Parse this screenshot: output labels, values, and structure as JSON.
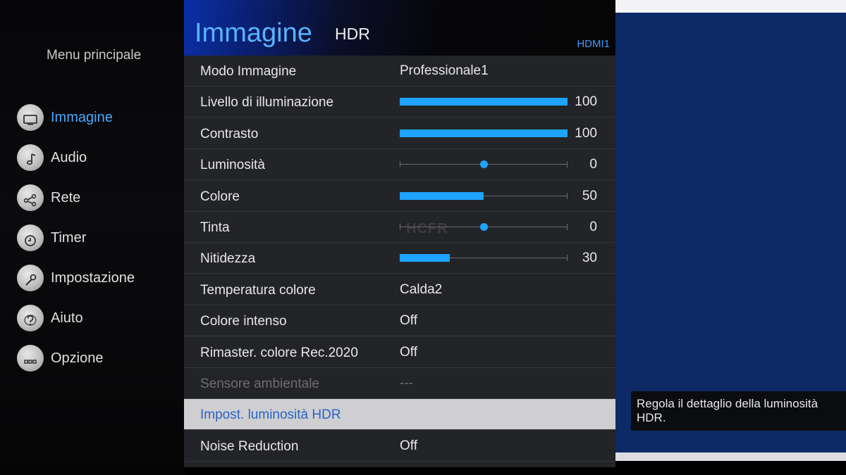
{
  "main_menu": {
    "title": "Menu principale",
    "items": [
      {
        "label": "Immagine",
        "icon": "tv-icon",
        "active": true
      },
      {
        "label": "Audio",
        "icon": "music-note-icon",
        "active": false
      },
      {
        "label": "Rete",
        "icon": "share-network-icon",
        "active": false
      },
      {
        "label": "Timer",
        "icon": "clock-icon",
        "active": false
      },
      {
        "label": "Impostazione",
        "icon": "wrench-icon",
        "active": false
      },
      {
        "label": "Aiuto",
        "icon": "help-icon",
        "active": false
      },
      {
        "label": "Opzione",
        "icon": "options-dots-icon",
        "active": false
      }
    ]
  },
  "panel": {
    "title": "Immagine",
    "subtitle": "HDR",
    "source": "HDMI1",
    "rows": [
      {
        "label": "Modo Immagine",
        "type": "value",
        "value": "Professionale1"
      },
      {
        "label": "Livello di illuminazione",
        "type": "slider",
        "value": "100",
        "level": 1.0,
        "style": "fill"
      },
      {
        "label": "Contrasto",
        "type": "slider",
        "value": "100",
        "level": 1.0,
        "style": "fill"
      },
      {
        "label": "Luminosità",
        "type": "slider",
        "value": "0",
        "level": 0.5,
        "style": "knob"
      },
      {
        "label": "Colore",
        "type": "slider",
        "value": "50",
        "level": 0.5,
        "style": "fill"
      },
      {
        "label": "Tinta",
        "type": "slider",
        "value": "0",
        "level": 0.5,
        "style": "knob"
      },
      {
        "label": "Nitidezza",
        "type": "slider",
        "value": "30",
        "level": 0.3,
        "style": "fill"
      },
      {
        "label": "Temperatura colore",
        "type": "value",
        "value": "Calda2"
      },
      {
        "label": "Colore intenso",
        "type": "value",
        "value": "Off"
      },
      {
        "label": "Rimaster. colore Rec.2020",
        "type": "value",
        "value": "Off"
      },
      {
        "label": "Sensore ambientale",
        "type": "value",
        "value": "---",
        "disabled": true
      },
      {
        "label": "Impost. luminosità HDR",
        "type": "value",
        "value": "",
        "selected": true
      },
      {
        "label": "Noise Reduction",
        "type": "value",
        "value": "Off"
      }
    ]
  },
  "help_text": "Regola il dettaglio della luminosità HDR.",
  "colors": {
    "accent": "#1ea3ff",
    "title": "#58b4ff",
    "selected_label": "#2a63c8",
    "panel_bg": "#232427"
  }
}
